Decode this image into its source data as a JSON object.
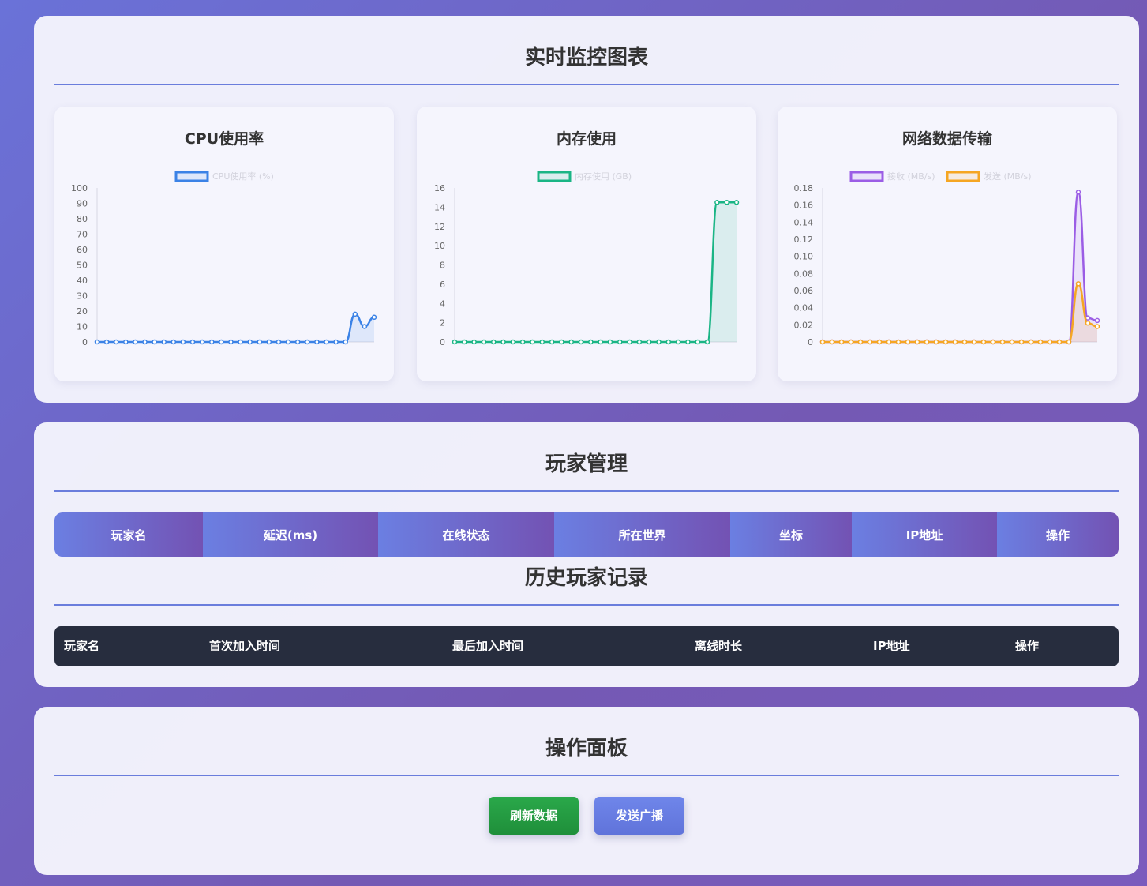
{
  "monitor": {
    "title": "实时监控图表"
  },
  "players": {
    "title": "玩家管理",
    "columns": [
      "玩家名",
      "延迟(ms)",
      "在线状态",
      "所在世界",
      "坐标",
      "IP地址",
      "操作"
    ]
  },
  "history": {
    "title": "历史玩家记录",
    "columns": [
      "玩家名",
      "首次加入时间",
      "最后加入时间",
      "离线时长",
      "IP地址",
      "操作"
    ]
  },
  "panel": {
    "title": "操作面板",
    "refresh_label": "刷新数据",
    "broadcast_label": "发送广播"
  },
  "colors": {
    "cpu": "#3b82e6",
    "memory": "#1ab585",
    "net_recv": "#9b5de5",
    "net_send": "#f5a623",
    "refresh": "#22a046",
    "broadcast": "#6a7ddc"
  },
  "chart_data": [
    {
      "type": "area",
      "title": "CPU使用率",
      "legend": "top-center",
      "ylim": [
        0,
        100
      ],
      "y_ticks": [
        "0",
        "10",
        "20",
        "30",
        "40",
        "50",
        "60",
        "70",
        "80",
        "90",
        "100"
      ],
      "series": [
        {
          "name": "CPU使用率 (%)",
          "color": "#3b82e6",
          "values": [
            0,
            0,
            0,
            0,
            0,
            0,
            0,
            0,
            0,
            0,
            0,
            0,
            0,
            0,
            0,
            0,
            0,
            0,
            0,
            0,
            0,
            0,
            0,
            0,
            0,
            0,
            0,
            18,
            10,
            16
          ]
        }
      ]
    },
    {
      "type": "area",
      "title": "内存使用",
      "legend": "top-center",
      "ylim": [
        0,
        16
      ],
      "y_ticks": [
        "0",
        "2",
        "4",
        "6",
        "8",
        "10",
        "12",
        "14",
        "16"
      ],
      "series": [
        {
          "name": "内存使用 (GB)",
          "color": "#1ab585",
          "values": [
            0,
            0,
            0,
            0,
            0,
            0,
            0,
            0,
            0,
            0,
            0,
            0,
            0,
            0,
            0,
            0,
            0,
            0,
            0,
            0,
            0,
            0,
            0,
            0,
            0,
            0,
            0,
            14.5,
            14.5,
            14.5
          ]
        }
      ]
    },
    {
      "type": "area",
      "title": "网络数据传输",
      "legend": "top-center",
      "ylim": [
        0,
        0.18
      ],
      "y_ticks": [
        "0",
        "0.02",
        "0.04",
        "0.06",
        "0.08",
        "0.10",
        "0.12",
        "0.14",
        "0.16",
        "0.18"
      ],
      "series": [
        {
          "name": "接收 (MB/s)",
          "color": "#9b5de5",
          "values": [
            0,
            0,
            0,
            0,
            0,
            0,
            0,
            0,
            0,
            0,
            0,
            0,
            0,
            0,
            0,
            0,
            0,
            0,
            0,
            0,
            0,
            0,
            0,
            0,
            0,
            0,
            0,
            0.175,
            0.028,
            0.025
          ]
        },
        {
          "name": "发送 (MB/s)",
          "color": "#f5a623",
          "values": [
            0,
            0,
            0,
            0,
            0,
            0,
            0,
            0,
            0,
            0,
            0,
            0,
            0,
            0,
            0,
            0,
            0,
            0,
            0,
            0,
            0,
            0,
            0,
            0,
            0,
            0,
            0,
            0.068,
            0.022,
            0.018
          ]
        }
      ]
    }
  ]
}
